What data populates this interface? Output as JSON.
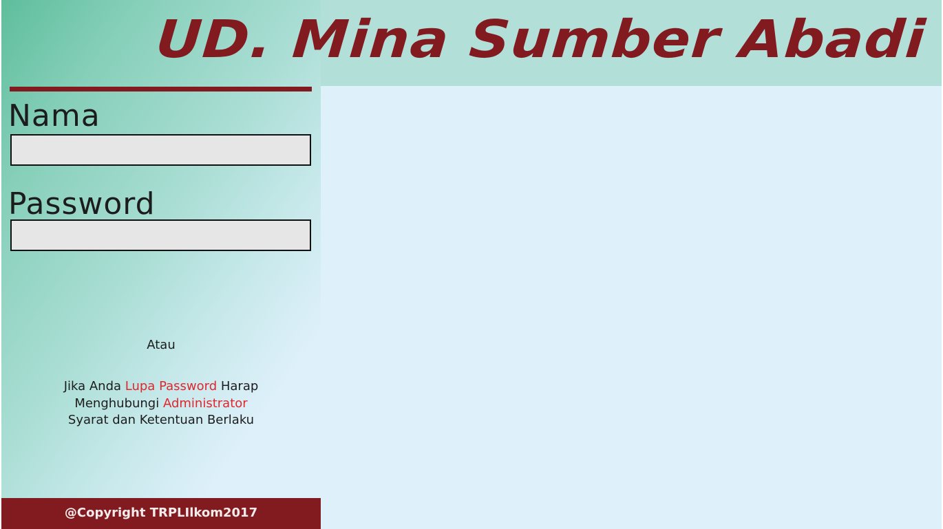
{
  "header": {
    "title": "UD. Mina Sumber Abadi"
  },
  "login": {
    "name_label": "Nama",
    "name_value": "",
    "name_placeholder": "",
    "password_label": "Password",
    "password_value": "",
    "password_placeholder": ""
  },
  "alternative": {
    "atau": "Atau"
  },
  "help": {
    "prefix": "Jika Anda ",
    "forgot_link": "Lupa Password",
    "middle": " Harap Menghubungi ",
    "admin_link": "Administrator",
    "terms": "Syarat dan Ketentuan Berlaku"
  },
  "footer": {
    "copyright": "@Copyright TRPLIlkom2017"
  },
  "colors": {
    "brand_maroon": "#821b20",
    "link_red": "#e0262c",
    "header_band": "#b3dfd9",
    "content_bg": "#def0fa",
    "gradient_green": "#5ebe9c"
  }
}
